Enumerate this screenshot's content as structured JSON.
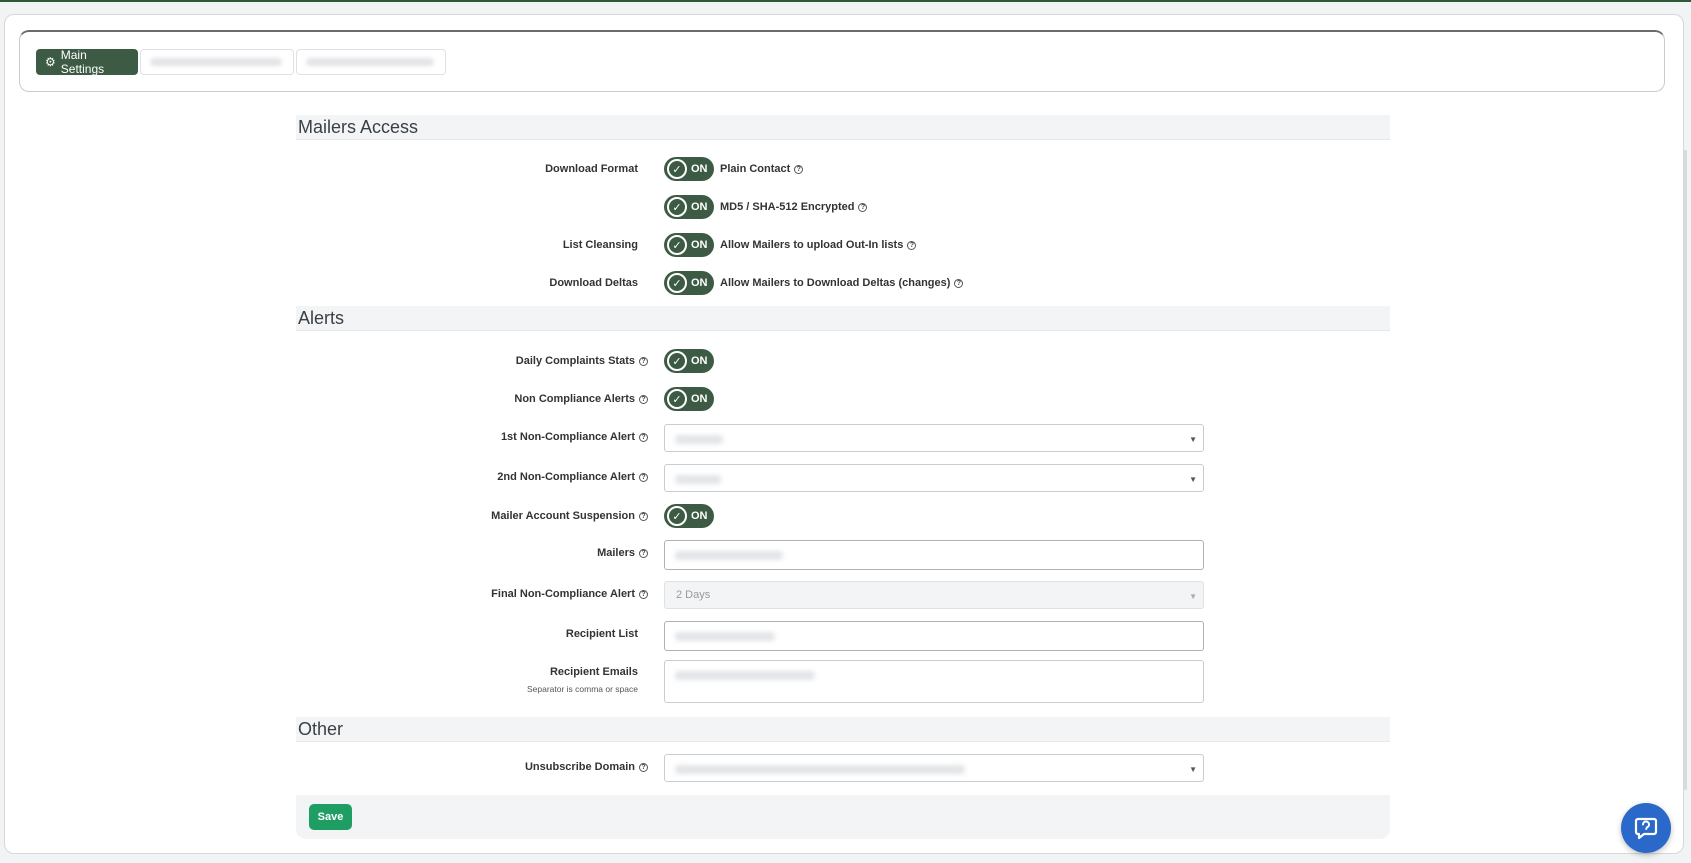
{
  "tabs": {
    "main_settings": "Main Settings"
  },
  "sections": {
    "mailers_access": "Mailers Access",
    "alerts": "Alerts",
    "other": "Other"
  },
  "mailers_access": {
    "download_format_label": "Download Format",
    "plain_contact_toggle": "ON",
    "plain_contact_text": "Plain Contact",
    "md5_toggle": "ON",
    "md5_text": "MD5 / SHA-512 Encrypted",
    "list_cleansing_label": "List Cleansing",
    "list_cleansing_toggle": "ON",
    "list_cleansing_text": "Allow Mailers to upload Out-In lists",
    "download_deltas_label": "Download Deltas",
    "download_deltas_toggle": "ON",
    "download_deltas_text": "Allow Mailers to Download Deltas (changes)"
  },
  "alerts": {
    "daily_complaints_label": "Daily Complaints Stats",
    "daily_complaints_toggle": "ON",
    "non_compliance_label": "Non Compliance Alerts",
    "non_compliance_toggle": "ON",
    "first_alert_label": "1st Non-Compliance Alert",
    "second_alert_label": "2nd Non-Compliance Alert",
    "suspension_label": "Mailer Account Suspension",
    "suspension_toggle": "ON",
    "mailers_label": "Mailers",
    "final_alert_label": "Final Non-Compliance Alert",
    "final_alert_value": "2 Days",
    "recipient_list_label": "Recipient List",
    "recipient_emails_label": "Recipient Emails",
    "recipient_emails_hint": "Separator is comma or space"
  },
  "other": {
    "unsubscribe_domain_label": "Unsubscribe Domain"
  },
  "actions": {
    "save_label": "Save"
  },
  "colors": {
    "primary_dark_green": "#3d5a45",
    "save_green": "#1e9e63",
    "chat_blue": "#2a68c9"
  },
  "icons": {
    "tab": "cogs-icon",
    "toggle": "check-circle-icon",
    "help": "question-circle-icon",
    "select": "caret-down-icon",
    "chat": "chat-support-icon"
  }
}
